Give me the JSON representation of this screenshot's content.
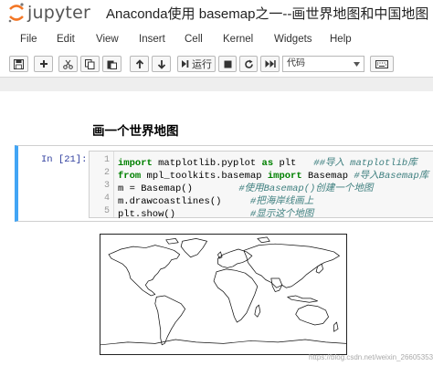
{
  "header": {
    "logo_text": "jupyter",
    "notebook_title": "Anaconda使用 basemap之一--画世界地图和中国地图"
  },
  "menubar": {
    "items": [
      "File",
      "Edit",
      "View",
      "Insert",
      "Cell",
      "Kernel",
      "Widgets",
      "Help"
    ]
  },
  "toolbar": {
    "run_label": "运行",
    "cell_type": "代码",
    "buttons": [
      "save-icon",
      "plus-icon",
      "cut-icon",
      "copy-icon",
      "paste-icon",
      "arrow-up-icon",
      "arrow-down-icon",
      "step-forward-icon",
      "stop-icon",
      "restart-icon",
      "fast-forward-icon",
      "keyboard-icon"
    ]
  },
  "notebook": {
    "heading": "画一个世界地图",
    "cell": {
      "prompt": "In [21]:",
      "line_numbers": [
        "1",
        "2",
        "3",
        "4",
        "5"
      ],
      "lines": [
        {
          "code_kw": "import",
          "code": " matplotlib.pyplot ",
          "code_kw2": "as",
          "code2": " plt",
          "comment": "   ##导入 matplotlib库"
        },
        {
          "code_kw": "from",
          "code": " mpl_toolkits.basemap ",
          "code_kw2": "import",
          "code2": " Basemap",
          "comment": " #导入Basemap库"
        },
        {
          "code_kw": "",
          "code": "m = Basemap()",
          "code_kw2": "",
          "code2": "",
          "comment": "        #使用Basemap()创建一个地图"
        },
        {
          "code_kw": "",
          "code": "m.drawcoastlines()",
          "code_kw2": "",
          "code2": "",
          "comment": "     #把海岸线画上"
        },
        {
          "code_kw": "",
          "code": "plt.show()",
          "code_kw2": "",
          "code2": "",
          "comment": "             #显示这个地图"
        }
      ]
    },
    "output": {
      "type": "world-coastline-map"
    }
  },
  "watermark": "https://blog.csdn.net/weixin_26605353",
  "colors": {
    "cell_border_accent": "#42a5f5",
    "prompt": "#303f9f",
    "keyword": "#008000",
    "comment": "#408080",
    "logo_orange": "#f37726"
  }
}
